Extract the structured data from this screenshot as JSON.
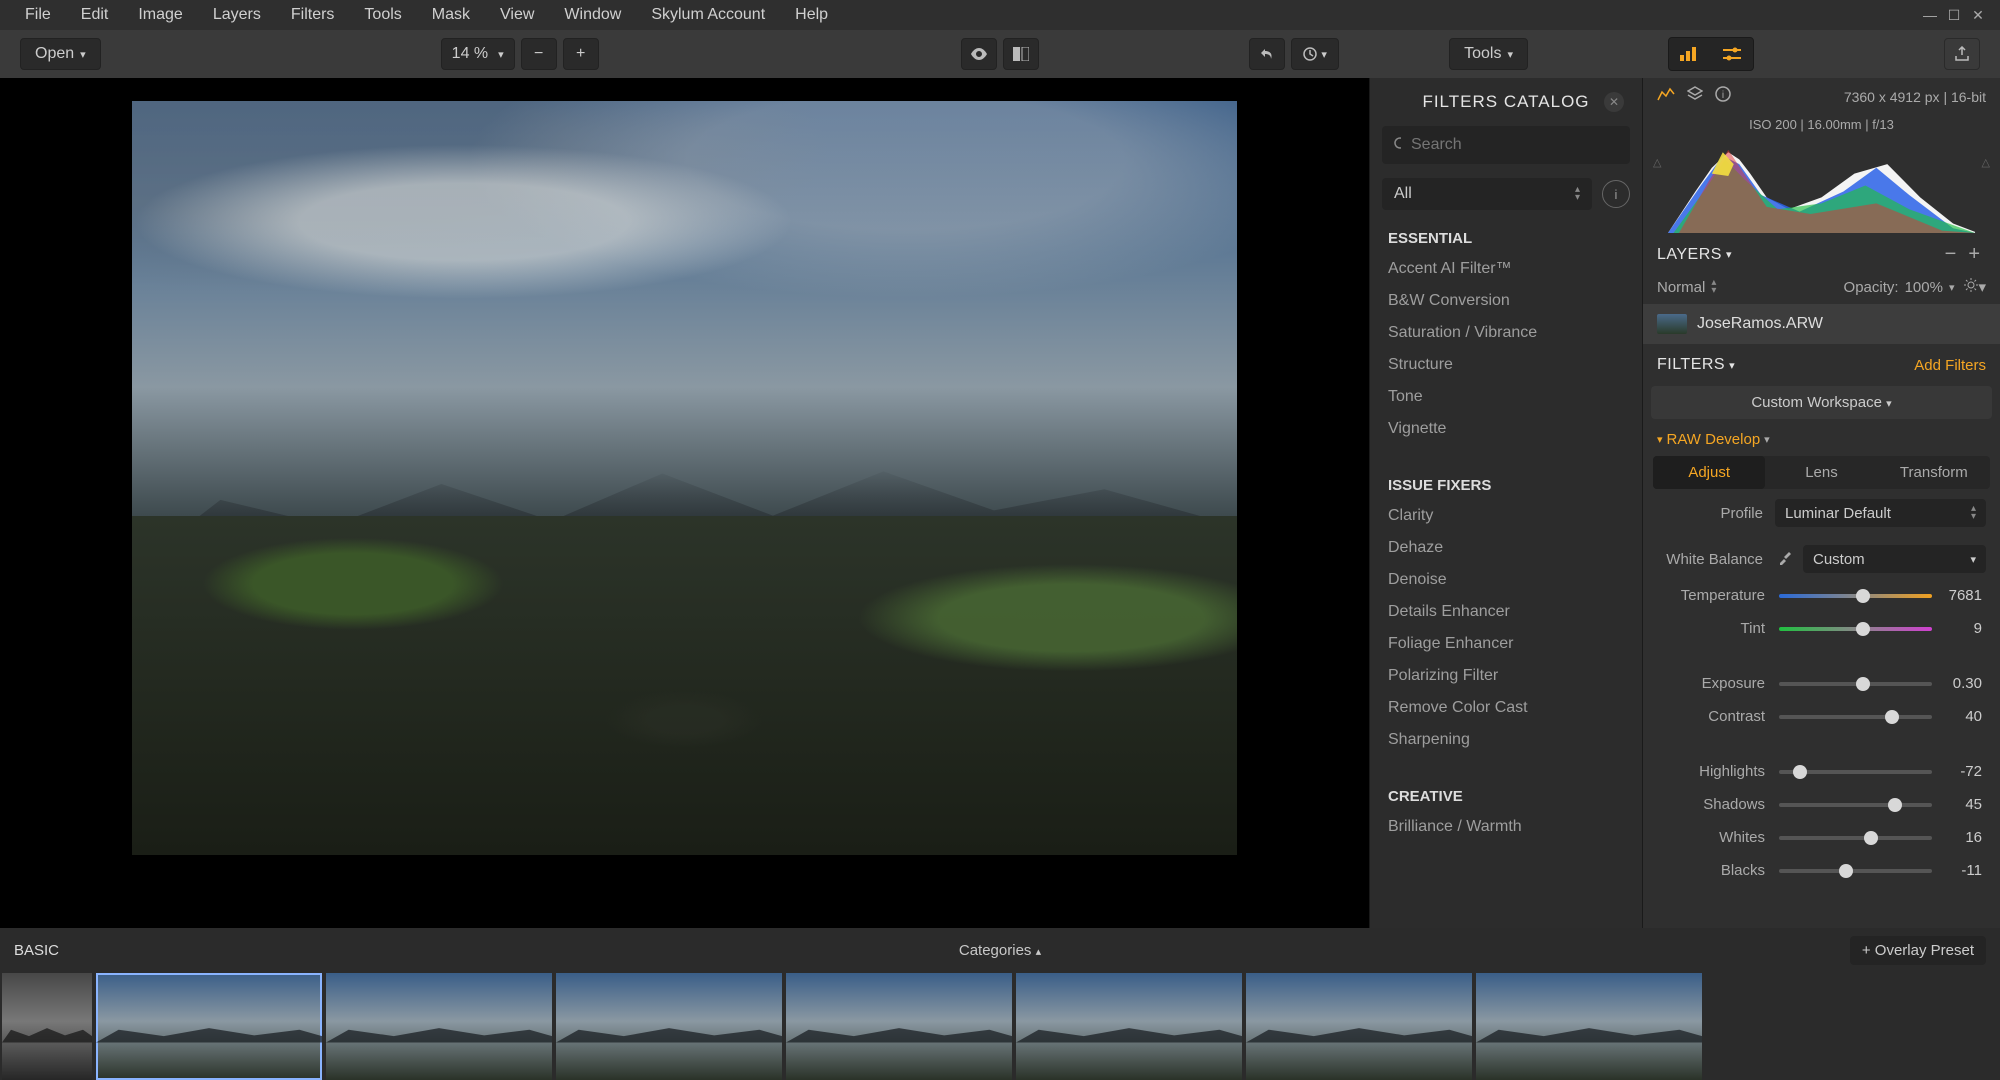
{
  "menu": [
    "File",
    "Edit",
    "Image",
    "Layers",
    "Filters",
    "Tools",
    "Mask",
    "View",
    "Window",
    "Skylum Account",
    "Help"
  ],
  "toolbar": {
    "open": "Open",
    "zoom": "14 %",
    "tools": "Tools"
  },
  "catalog": {
    "title": "FILTERS CATALOG",
    "search_placeholder": "Search",
    "scope": "All",
    "sections": [
      {
        "name": "ESSENTIAL",
        "items": [
          "Accent AI Filter™",
          "B&W Conversion",
          "Saturation / Vibrance",
          "Structure",
          "Tone",
          "Vignette"
        ]
      },
      {
        "name": "ISSUE FIXERS",
        "items": [
          "Clarity",
          "Dehaze",
          "Denoise",
          "Details Enhancer",
          "Foliage Enhancer",
          "Polarizing Filter",
          "Remove Color Cast",
          "Sharpening"
        ]
      },
      {
        "name": "CREATIVE",
        "items": [
          "Brilliance / Warmth"
        ]
      }
    ]
  },
  "right": {
    "dims": "7360 x 4912 px  |  16-bit",
    "exif": "ISO 200  |  16.00mm  |  f/13",
    "layers_title": "LAYERS",
    "blend": "Normal",
    "opacity_lbl": "Opacity:",
    "opacity_val": "100%",
    "layer_name": "JoseRamos.ARW",
    "filters_title": "FILTERS",
    "add_filters": "Add Filters",
    "workspace": "Custom Workspace",
    "raw": "RAW Develop",
    "tabs": [
      "Adjust",
      "Lens",
      "Transform"
    ],
    "active_tab": 0,
    "profile_lbl": "Profile",
    "profile_val": "Luminar Default",
    "wb_lbl": "White Balance",
    "wb_val": "Custom",
    "sliders": [
      {
        "label": "Temperature",
        "value": "7681",
        "pos": 55,
        "track": "temp"
      },
      {
        "label": "Tint",
        "value": "9",
        "pos": 55,
        "track": "tint"
      },
      {
        "label": "Exposure",
        "value": "0.30",
        "pos": 55,
        "track": "grey"
      },
      {
        "label": "Contrast",
        "value": "40",
        "pos": 74,
        "track": "grey"
      },
      {
        "label": "Highlights",
        "value": "-72",
        "pos": 14,
        "track": "grey"
      },
      {
        "label": "Shadows",
        "value": "45",
        "pos": 76,
        "track": "grey"
      },
      {
        "label": "Whites",
        "value": "16",
        "pos": 60,
        "track": "grey"
      },
      {
        "label": "Blacks",
        "value": "-11",
        "pos": 44,
        "track": "grey"
      }
    ]
  },
  "strip": {
    "title": "BASIC",
    "categories": "Categories",
    "overlay": "+ Overlay Preset",
    "thumb_count": 8
  }
}
